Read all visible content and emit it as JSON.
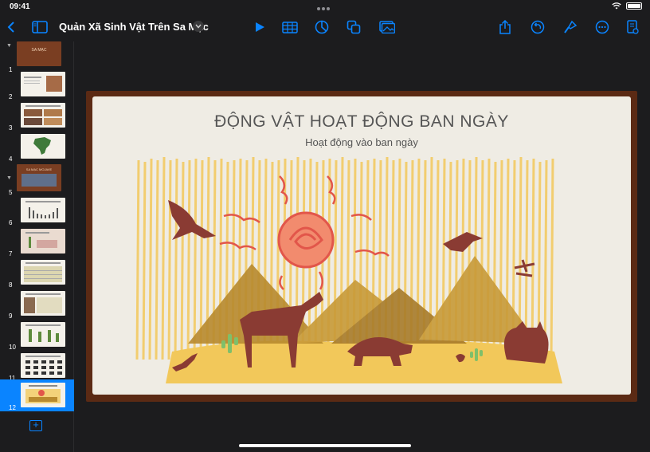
{
  "status": {
    "time": "09:41"
  },
  "toolbar": {
    "title": "Quản Xã Sinh Vật Trên Sa Mạc",
    "icons": [
      "back-icon",
      "sidebar-icon",
      "play-icon",
      "table-icon",
      "chart-icon",
      "shapes-icon",
      "media-icon",
      "share-icon",
      "undo-icon",
      "format-icon",
      "more-icon",
      "document-icon"
    ]
  },
  "sidebar": {
    "slides": [
      {
        "num": "1",
        "label": "SA MẠC"
      },
      {
        "num": "2"
      },
      {
        "num": "3"
      },
      {
        "num": "4"
      },
      {
        "num": "5",
        "label": "SA MẠC MOJAVE"
      },
      {
        "num": "6"
      },
      {
        "num": "7"
      },
      {
        "num": "8"
      },
      {
        "num": "9"
      },
      {
        "num": "10"
      },
      {
        "num": "11"
      },
      {
        "num": "12"
      }
    ]
  },
  "slide": {
    "title": "ĐỘNG VẬT HOẠT ĐỘNG BAN NGÀY",
    "subtitle": "Hoạt động vào ban ngày"
  },
  "colors": {
    "accent": "#0a84ff",
    "frame": "#5b2a14",
    "animal": "#8a3b33",
    "sun": "#e2564a",
    "mountain": "#b88a2e",
    "sand": "#f2c85a"
  }
}
